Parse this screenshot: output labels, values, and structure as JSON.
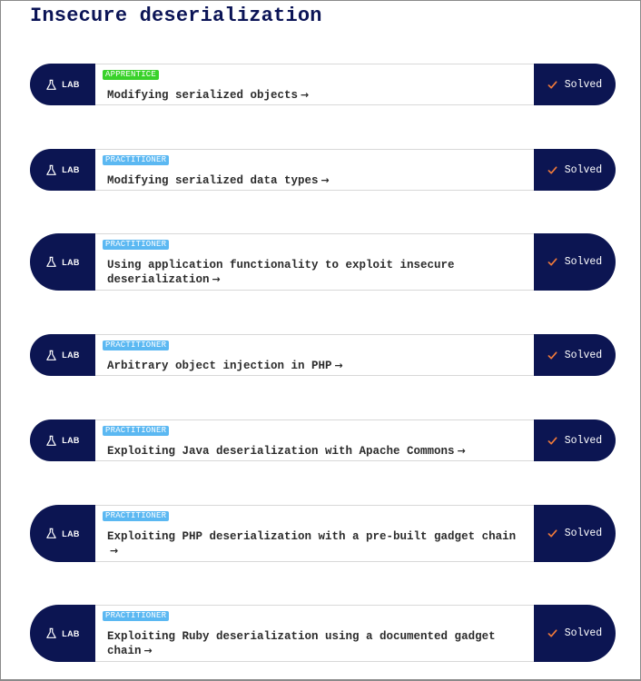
{
  "page": {
    "title": "Insecure deserialization"
  },
  "colors": {
    "navy": "#0c1552",
    "apprentice_badge": "#39d22a",
    "practitioner_badge": "#5bb8f2",
    "check": "#f07a3a"
  },
  "labs": [
    {
      "tag_label": "LAB",
      "level": "APPRENTICE",
      "title": "Modifying serialized objects",
      "status": "Solved"
    },
    {
      "tag_label": "LAB",
      "level": "PRACTITIONER",
      "title": "Modifying serialized data types",
      "status": "Solved"
    },
    {
      "tag_label": "LAB",
      "level": "PRACTITIONER",
      "title": "Using application functionality to exploit insecure deserialization",
      "status": "Solved"
    },
    {
      "tag_label": "LAB",
      "level": "PRACTITIONER",
      "title": "Arbitrary object injection in PHP",
      "status": "Solved"
    },
    {
      "tag_label": "LAB",
      "level": "PRACTITIONER",
      "title": "Exploiting Java deserialization with Apache Commons",
      "status": "Solved"
    },
    {
      "tag_label": "LAB",
      "level": "PRACTITIONER",
      "title": "Exploiting PHP deserialization with a pre-built gadget chain",
      "status": "Solved"
    },
    {
      "tag_label": "LAB",
      "level": "PRACTITIONER",
      "title": "Exploiting Ruby deserialization using a documented gadget chain",
      "status": "Solved"
    }
  ]
}
